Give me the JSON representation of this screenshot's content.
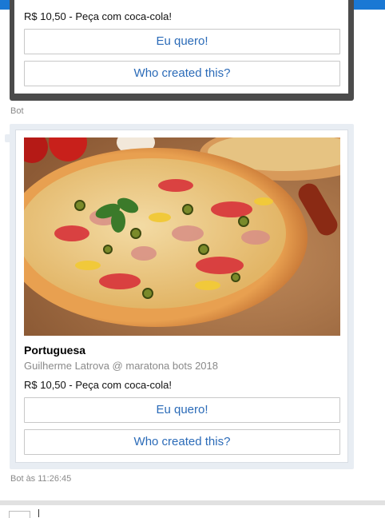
{
  "card_previous": {
    "price_text": "R$ 10,50 - Peça com coca-cola!",
    "buttons": [
      "Eu quero!",
      "Who created this?"
    ]
  },
  "sender_label_1": "Bot",
  "card_current": {
    "image_alt": "pizza",
    "title": "Portuguesa",
    "subtitle": "Guilherme Latrova @ maratona bots 2018",
    "price_text": "R$ 10,50 - Peça com coca-cola!",
    "buttons": [
      "Eu quero!",
      "Who created this?"
    ]
  },
  "sender_label_2": "Bot às 11:26:45",
  "colors": {
    "accent": "#1a78d4",
    "button_text": "#2b6bb8",
    "card_frame_dark": "#4b4b4b",
    "card_frame_light": "#e8edf3"
  }
}
